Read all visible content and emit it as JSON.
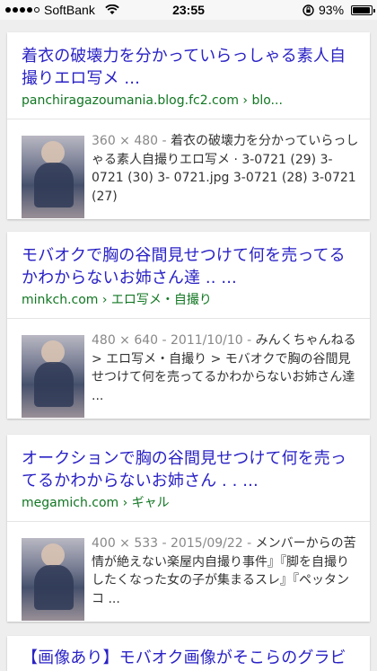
{
  "status_bar": {
    "carrier": "SoftBank",
    "time": "23:55",
    "battery": "93%"
  },
  "results": [
    {
      "title": "着衣の破壊力を分かっていらっしゃる素人自撮りエロ写メ ...",
      "url": "panchiragazoumania.blog.fc2.com › blo...",
      "meta": "360 × 480 - ",
      "snippet": "着衣の破壊力を分かっていらっしゃる素人自撮りエロ写メ · 3-0721 (29) 3-0721 (30) 3- 0721.jpg 3-0721 (28) 3-0721 (27)"
    },
    {
      "title": "モバオクで胸の谷間見せつけて何を売ってるかわからないお姉さん達 .. ...",
      "url": "minkch.com › エロ写メ・自撮り",
      "meta": "480 × 640 - 2011/10/10 - ",
      "snippet": "みんくちゃんねる > エロ写メ・自撮り > モバオクで胸の谷間見せつけて何を売ってるかわからないお姉さん達 ..."
    },
    {
      "title": "オークションで胸の谷間見せつけて何を売ってるかわからないお姉さん . . ...",
      "url": "megamich.com › ギャル",
      "meta": "400 × 533 - 2015/09/22 - ",
      "snippet": "メンバーからの苦情が絶えない楽屋内自撮り事件』『脚を自撮りしたくなった女の子が集まるスレ』『ペッタンコ ..."
    },
    {
      "title": "【画像あり】モバオク画像がそこらのグラビ"
    }
  ]
}
